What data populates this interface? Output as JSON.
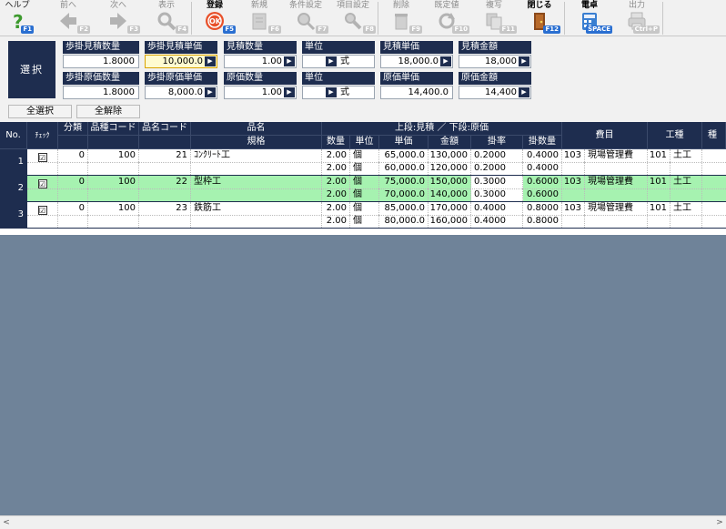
{
  "toolbar": {
    "help": {
      "label": "ヘルプ",
      "key": "F1"
    },
    "prev": {
      "label": "前へ",
      "key": "F2"
    },
    "next": {
      "label": "次へ",
      "key": "F3"
    },
    "display": {
      "label": "表示",
      "key": "F4"
    },
    "register": {
      "label": "登録",
      "key": "F5"
    },
    "new": {
      "label": "新規",
      "key": "F6"
    },
    "condition": {
      "label": "条件設定",
      "key": "F7"
    },
    "items": {
      "label": "項目設定",
      "key": "F8"
    },
    "delete": {
      "label": "削除",
      "key": "F9"
    },
    "default": {
      "label": "既定値",
      "key": "F10"
    },
    "copy": {
      "label": "複写",
      "key": "F11"
    },
    "close": {
      "label": "閉じる",
      "key": "F12"
    },
    "calc": {
      "label": "電卓",
      "key": "SPACE"
    },
    "output": {
      "label": "出力",
      "key": "Ctrl+P"
    }
  },
  "select_label": "選択",
  "fields": {
    "rate_qty": {
      "label": "歩掛見積数量",
      "value": "1.8000"
    },
    "rate_price": {
      "label": "歩掛見積単価",
      "value": "10,000.0"
    },
    "est_qty": {
      "label": "見積数量",
      "value": "1.00"
    },
    "unit1": {
      "label": "単位",
      "value": "式"
    },
    "est_unit_price": {
      "label": "見積単価",
      "value": "18,000.0"
    },
    "est_amount": {
      "label": "見積金額",
      "value": "18,000"
    },
    "cost_rate_qty": {
      "label": "歩掛原価数量",
      "value": "1.8000"
    },
    "cost_rate_price": {
      "label": "歩掛原価単価",
      "value": "8,000.0"
    },
    "cost_qty": {
      "label": "原価数量",
      "value": "1.00"
    },
    "unit2": {
      "label": "単位",
      "value": "式"
    },
    "cost_unit_price": {
      "label": "原価単価",
      "value": "14,400.0"
    },
    "cost_amount": {
      "label": "原価金額",
      "value": "14,400"
    }
  },
  "buttons": {
    "select_all": "全選択",
    "deselect_all": "全解除"
  },
  "headers": {
    "no": "No.",
    "check": "ﾁｪｯｸ",
    "category": "分類",
    "item_code": "品種コード",
    "name_code": "品名コード",
    "name": "品名",
    "spec": "規格",
    "upper_lower": "上段:見積 ／ 下段:原価",
    "qty": "数量",
    "unit": "単位",
    "unit_price": "単価",
    "amount": "金額",
    "rate": "掛率",
    "rate_qty": "掛数量",
    "expense": "費目",
    "process": "工種",
    "extra": "種"
  },
  "rows": [
    {
      "no": "1",
      "check": "☑",
      "category": "0",
      "item_code": "100",
      "name_code": "21",
      "name": "ｺﾝｸﾘｰﾄ工",
      "est": {
        "qty": "2.00",
        "unit": "個",
        "unit_price": "65,000.0",
        "amount": "130,000",
        "rate": "0.2000",
        "rate_qty": "0.4000"
      },
      "cost": {
        "qty": "2.00",
        "unit": "個",
        "unit_price": "60,000.0",
        "amount": "120,000",
        "rate": "0.2000",
        "rate_qty": "0.4000"
      },
      "expense_code": "103",
      "expense": "現場管理費",
      "process_code": "101",
      "process": "土工"
    },
    {
      "no": "2",
      "check": "☑",
      "category": "0",
      "item_code": "100",
      "name_code": "22",
      "name": "型枠工",
      "est": {
        "qty": "2.00",
        "unit": "個",
        "unit_price": "75,000.0",
        "amount": "150,000",
        "rate": "0.3000",
        "rate_qty": "0.6000"
      },
      "cost": {
        "qty": "2.00",
        "unit": "個",
        "unit_price": "70,000.0",
        "amount": "140,000",
        "rate": "0.3000",
        "rate_qty": "0.6000"
      },
      "expense_code": "103",
      "expense": "現場管理費",
      "process_code": "101",
      "process": "土工"
    },
    {
      "no": "3",
      "check": "☑",
      "category": "0",
      "item_code": "100",
      "name_code": "23",
      "name": "鉄筋工",
      "est": {
        "qty": "2.00",
        "unit": "個",
        "unit_price": "85,000.0",
        "amount": "170,000",
        "rate": "0.4000",
        "rate_qty": "0.8000"
      },
      "cost": {
        "qty": "2.00",
        "unit": "個",
        "unit_price": "80,000.0",
        "amount": "160,000",
        "rate": "0.4000",
        "rate_qty": "0.8000"
      },
      "expense_code": "103",
      "expense": "現場管理費",
      "process_code": "101",
      "process": "土工"
    }
  ],
  "colors": {
    "header": "#1e2d4f",
    "selected_row": "#a6f2b0",
    "background": "#6f8399",
    "highlight_field": "#fffbd0"
  }
}
